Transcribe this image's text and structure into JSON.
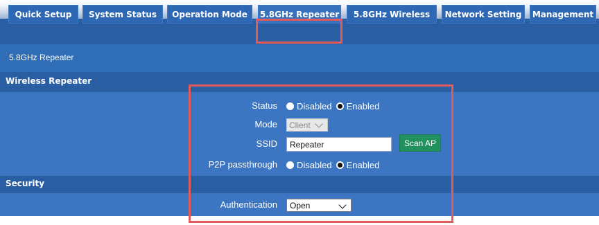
{
  "tabs": [
    {
      "label": "Quick Setup"
    },
    {
      "label": "System Status"
    },
    {
      "label": "Operation Mode"
    },
    {
      "label": "5.8GHz Repeater",
      "active": true
    },
    {
      "label": "5.8GHz Wireless"
    },
    {
      "label": "Network Setting"
    },
    {
      "label": "Management"
    }
  ],
  "subnav": {
    "item": "5.8GHz Repeater"
  },
  "wireless_repeater": {
    "section_title": "Wireless Repeater",
    "status": {
      "label": "Status",
      "options": [
        "Disabled",
        "Enabled"
      ],
      "selected": "Enabled"
    },
    "mode": {
      "label": "Mode",
      "value": "Client",
      "disabled": true
    },
    "ssid": {
      "label": "SSID",
      "value": "Repeater",
      "scan_button": "Scan AP"
    },
    "p2p": {
      "label": "P2P passthrough",
      "options": [
        "Disabled",
        "Enabled"
      ],
      "selected": "Enabled"
    }
  },
  "security": {
    "section_title": "Security",
    "authentication": {
      "label": "Authentication",
      "value": "Open"
    }
  },
  "colors": {
    "tab_bg": "#2e68b4",
    "band_dark": "#2a5ea3",
    "band_light": "#3c75c2",
    "scan_button": "#21925e",
    "highlight": "#e35a5a"
  }
}
